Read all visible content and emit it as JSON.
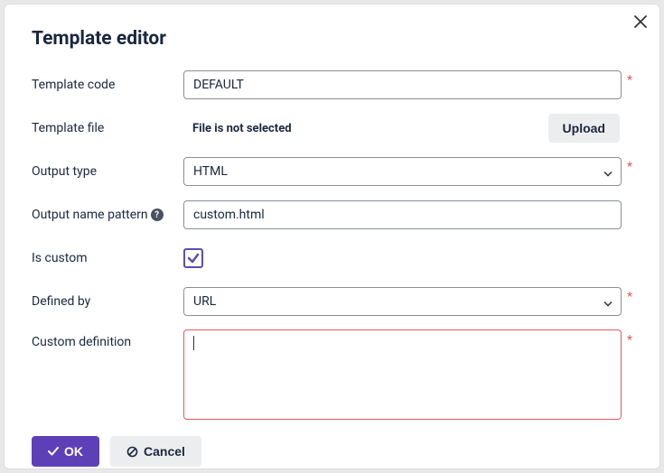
{
  "dialog": {
    "title": "Template editor",
    "labels": {
      "templateCode": "Template code",
      "templateFile": "Template file",
      "outputType": "Output type",
      "outputNamePattern": "Output name pattern",
      "isCustom": "Is custom",
      "definedBy": "Defined by",
      "customDefinition": "Custom definition"
    },
    "values": {
      "templateCode": "DEFAULT",
      "fileStatus": "File is not selected",
      "outputType": "HTML",
      "outputNamePattern": "custom.html",
      "isCustomChecked": true,
      "definedBy": "URL",
      "customDefinition": ""
    },
    "buttons": {
      "upload": "Upload",
      "ok": "OK",
      "cancel": "Cancel"
    },
    "requiredMark": "*"
  }
}
